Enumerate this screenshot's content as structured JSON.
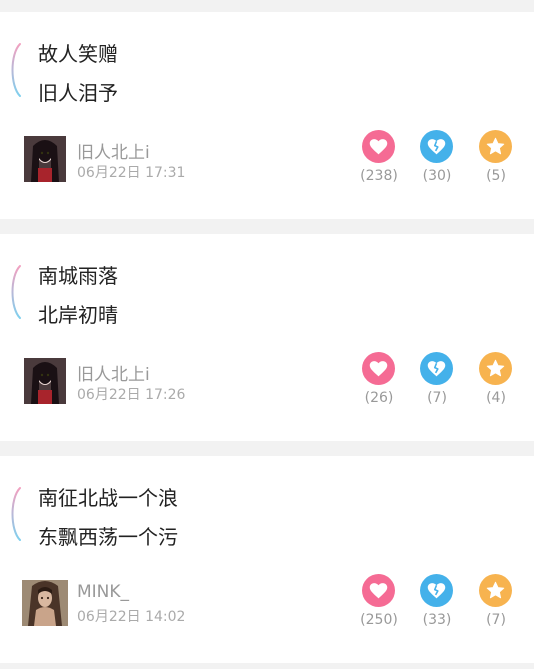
{
  "colors": {
    "like": "#f56b94",
    "broken_heart": "#44b1ea",
    "favorite": "#f7b34f",
    "bracket_top": "#f2a0c0",
    "bracket_bottom": "#7fd0ee"
  },
  "icons": {
    "like": "heart-icon",
    "dislike": "broken-heart-icon",
    "favorite": "star-icon"
  },
  "posts": [
    {
      "line1": "故人笑赠",
      "line2": "旧人泪予",
      "author": "旧人北上i",
      "time": "06月22日 17:31",
      "likes": "(238)",
      "breaks": "(30)",
      "favorites": "(5)"
    },
    {
      "line1": "南城雨落",
      "line2": "北岸初晴",
      "author": "旧人北上i",
      "time": "06月22日 17:26",
      "likes": "(26)",
      "breaks": "(7)",
      "favorites": "(4)"
    },
    {
      "line1": "南征北战一个浪",
      "line2": "东飘西荡一个污",
      "author": "MINK_",
      "time": "06月22日 14:02",
      "likes": "(250)",
      "breaks": "(33)",
      "favorites": "(7)"
    }
  ]
}
